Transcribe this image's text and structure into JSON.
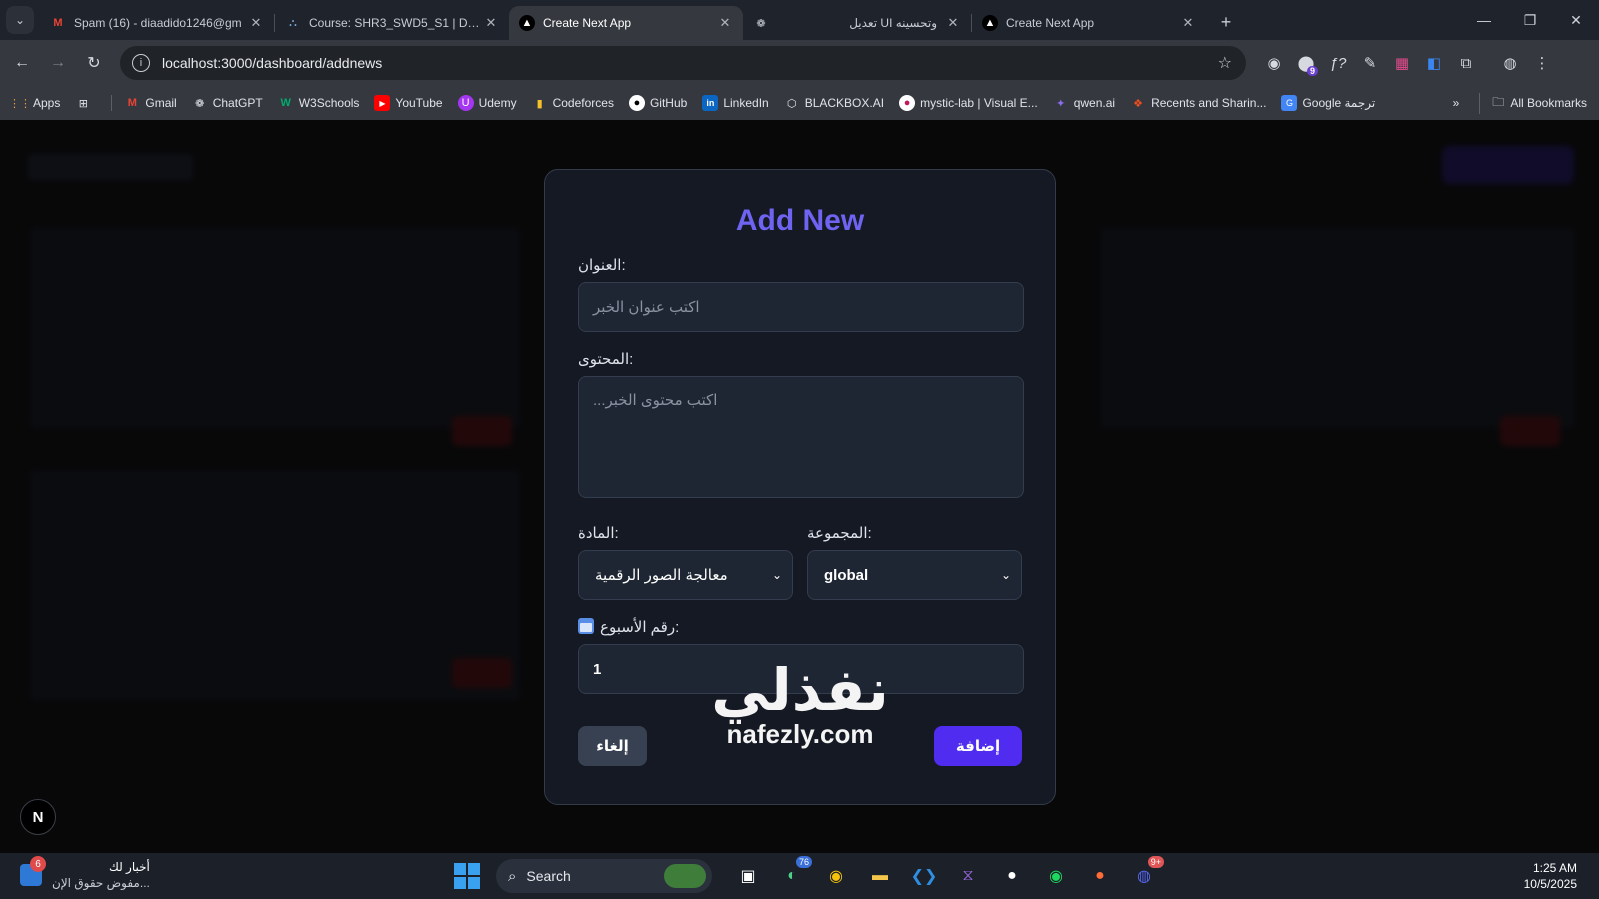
{
  "browser": {
    "tabs": [
      {
        "title": "Spam (16) - diaadido1246@gm",
        "icon": "gmail-icon",
        "active": false
      },
      {
        "title": "Course: SHR3_SWD5_S1 | DEPI",
        "icon": "course-icon",
        "active": false
      },
      {
        "title": "Create Next App",
        "icon": "nextjs-icon",
        "active": true
      },
      {
        "title": "تعديل UI وتحسينه",
        "icon": "chatgpt-icon",
        "active": false
      },
      {
        "title": "Create Next App",
        "icon": "nextjs-icon",
        "active": false
      }
    ],
    "url": "localhost:3000/dashboard/addnews",
    "extensions_badge": "9",
    "bookmarks": [
      {
        "label": "Apps",
        "icon": "apps-grid-icon"
      },
      {
        "label": "",
        "icon": "tab-groups-icon"
      },
      {
        "label": "Gmail",
        "icon": "gmail-icon"
      },
      {
        "label": "ChatGPT",
        "icon": "chatgpt-icon"
      },
      {
        "label": "W3Schools",
        "icon": "w3schools-icon"
      },
      {
        "label": "YouTube",
        "icon": "youtube-icon"
      },
      {
        "label": "Udemy",
        "icon": "udemy-icon"
      },
      {
        "label": "Codeforces",
        "icon": "codeforces-icon"
      },
      {
        "label": "GitHub",
        "icon": "github-icon"
      },
      {
        "label": "LinkedIn",
        "icon": "linkedin-icon"
      },
      {
        "label": "BLACKBOX.AI",
        "icon": "blackbox-icon"
      },
      {
        "label": "mystic-lab | Visual E...",
        "icon": "mystic-icon"
      },
      {
        "label": "qwen.ai",
        "icon": "qwen-icon"
      },
      {
        "label": "Recents and Sharin...",
        "icon": "figma-icon"
      },
      {
        "label": "Google ترجمة",
        "icon": "translate-icon"
      }
    ],
    "all_bookmarks": "All Bookmarks"
  },
  "form": {
    "title": "Add New",
    "title_label": "العنوان:",
    "title_placeholder": "اكتب عنوان الخبر",
    "content_label": "المحتوى:",
    "content_placeholder": "اكتب محتوى الخبر...",
    "subject_label": "المادة:",
    "subject_value": "معالجة الصور الرقمية",
    "group_label": "المجموعة:",
    "group_value": "global",
    "week_label": "رقم الأسبوع:",
    "week_value": "1",
    "cancel_label": "إلغاء",
    "submit_label": "إضافة"
  },
  "nextjs_badge": "N",
  "watermark": {
    "arabic": "نفذلي",
    "latin": "nafezly.com"
  },
  "taskbar": {
    "news_title": "أخبار لك",
    "news_subtitle": "مفوض حقوق الإن...",
    "news_badge": "6",
    "search_label": "Search",
    "badge_76": "76",
    "badge_discord": "9+",
    "time": "1:25 AM",
    "date": "10/5/2025"
  },
  "colors": {
    "accent": "#6f63f2",
    "submit": "#4f2cf0",
    "cancel": "#374151",
    "modal_bg": "#141923"
  }
}
